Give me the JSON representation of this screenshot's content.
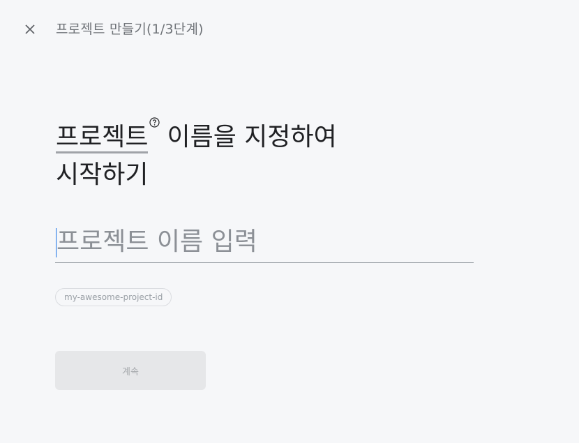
{
  "header": {
    "close_icon": "close-icon",
    "step_title": "프로젝트 만들기(1/3단계)"
  },
  "heading": {
    "term": "프로젝트",
    "help_icon": "help-circle-icon",
    "rest_line1": "이름을 지정하여",
    "line2": "시작하기"
  },
  "name_input": {
    "value": "",
    "placeholder": "프로젝트 이름 입력"
  },
  "project_id": {
    "value": "my-awesome-project-id"
  },
  "actions": {
    "continue_label": "계속"
  },
  "colors": {
    "background": "#f6f7f9",
    "button_disabled_bg": "#e6e7e9",
    "caret": "#1a73e8"
  }
}
